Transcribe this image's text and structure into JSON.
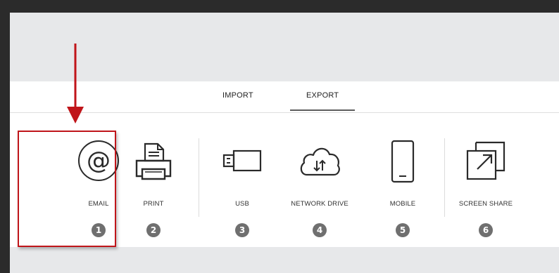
{
  "tabs": [
    {
      "label": "IMPORT",
      "active": false
    },
    {
      "label": "EXPORT",
      "active": true
    }
  ],
  "items": [
    {
      "label": "EMAIL",
      "number": "1",
      "icon": "at-sign-icon"
    },
    {
      "label": "PRINT",
      "number": "2",
      "icon": "printer-icon"
    },
    {
      "label": "USB",
      "number": "3",
      "icon": "usb-drive-icon"
    },
    {
      "label": "NETWORK DRIVE",
      "number": "4",
      "icon": "cloud-sync-icon"
    },
    {
      "label": "MOBILE",
      "number": "5",
      "icon": "mobile-phone-icon"
    },
    {
      "label": "SCREEN SHARE",
      "number": "6",
      "icon": "screen-share-icon"
    }
  ],
  "colors": {
    "annotation": "#c0151a",
    "band": "#e7e8ea",
    "badge": "#6f6f6f"
  }
}
